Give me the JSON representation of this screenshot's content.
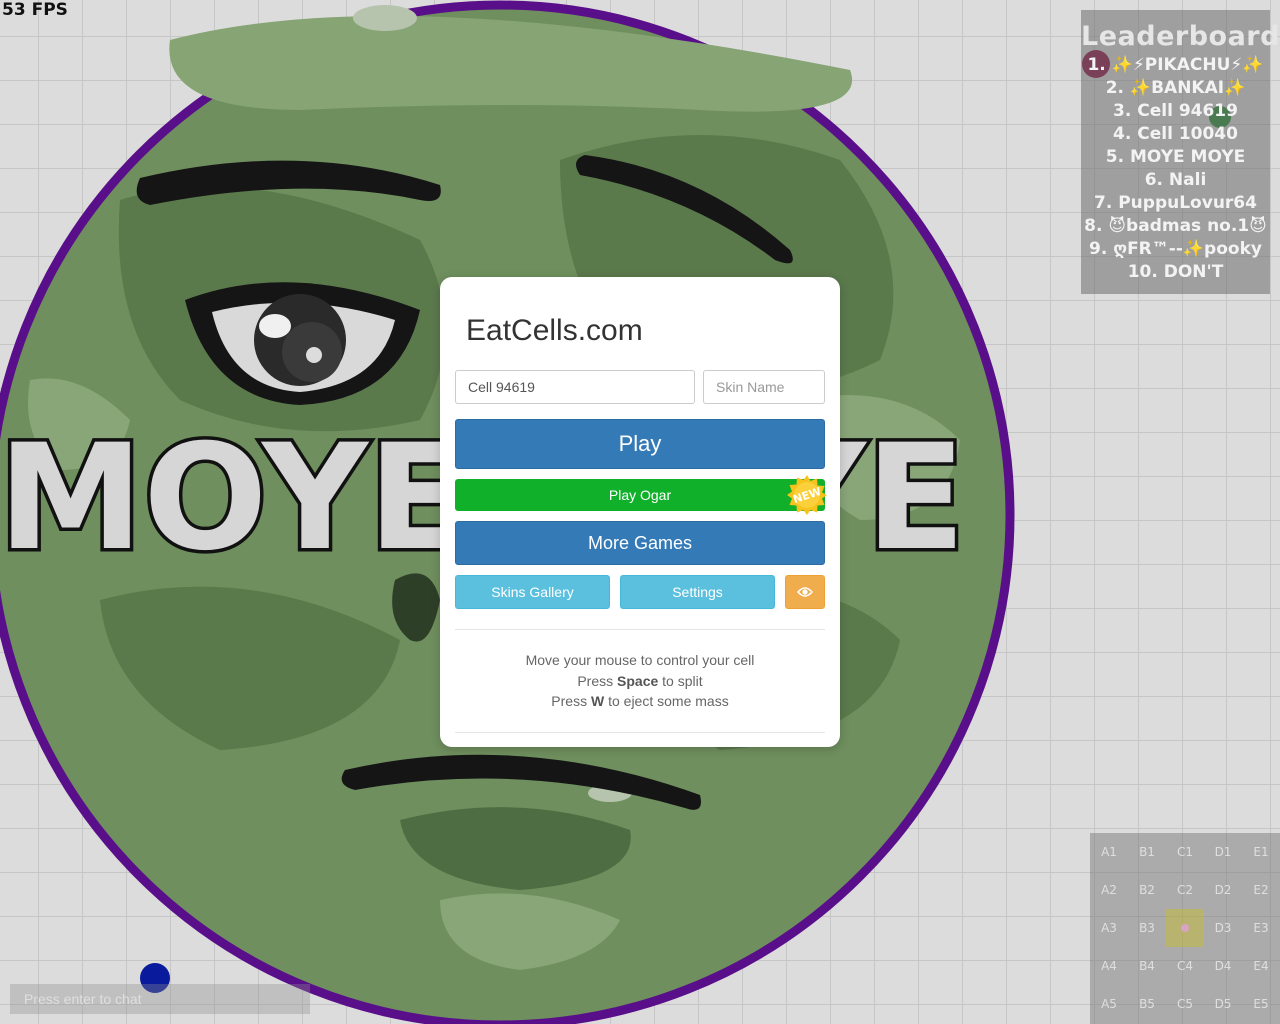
{
  "hud": {
    "fps": "53 FPS"
  },
  "cell": {
    "name": "MOYE MOYE",
    "visible_text": "MOYE",
    "visible_text_tail": "YE",
    "body_color": "#6f8f5e",
    "border_color": "#5a0f8a"
  },
  "leaderboard": {
    "title": "Leaderboard",
    "entries": [
      "1. ✨⚡PIKACHU⚡✨",
      "2. ✨BANKAI✨",
      "3. Cell 94619",
      "4. Cell 10040",
      "5. MOYE MOYE",
      "6. Nali",
      "7. PuppuLovur64",
      "8. 😈badmas no.1😈",
      "9. ღFR™--✨pooky",
      "10. DON'T"
    ]
  },
  "modal": {
    "title": "EatCells.com",
    "nick_value": "Cell 94619",
    "skin_placeholder": "Skin Name",
    "play_label": "Play",
    "ogar_label": "Play Ogar",
    "new_badge": "NEW",
    "more_games_label": "More Games",
    "skins_label": "Skins Gallery",
    "settings_label": "Settings",
    "eye_icon": "eye-icon",
    "help": {
      "line1": "Move your mouse to control your cell",
      "line2_pre": "Press",
      "line2_key": "Space",
      "line2_post": "to split",
      "line3_pre": "Press",
      "line3_key": "W",
      "line3_post": "to eject some mass"
    }
  },
  "chat": {
    "placeholder": "Press enter to chat"
  },
  "minimap": {
    "cells": [
      "A1",
      "B1",
      "C1",
      "D1",
      "E1",
      "A2",
      "B2",
      "C2",
      "D2",
      "E2",
      "A3",
      "B3",
      "C3",
      "D3",
      "E3",
      "A4",
      "B4",
      "C4",
      "D4",
      "E4",
      "A5",
      "B5",
      "C5",
      "D5",
      "E5"
    ],
    "current": "C3"
  },
  "colors": {
    "play": "#337ab7",
    "ogar": "#11b02b",
    "info": "#5bc0de",
    "warning": "#f0ad4e",
    "badge": "#f7c21b"
  }
}
